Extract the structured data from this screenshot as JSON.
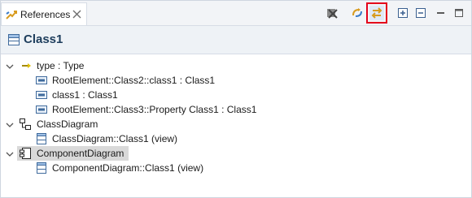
{
  "tab": {
    "label": "References"
  },
  "header": {
    "title": "Class1"
  },
  "tree": {
    "type_node": "type : Type",
    "ref1": "RootElement::Class2::class1 : Class1",
    "ref2": "class1 : Class1",
    "ref3": "RootElement::Class3::Property Class1 : Class1",
    "class_diagram": "ClassDiagram",
    "class_diagram_child": "ClassDiagram::Class1 (view)",
    "component_diagram": "ComponentDiagram",
    "component_diagram_child": "ComponentDiagram::Class1 (view)"
  },
  "colors": {
    "highlight_border": "#e4001b",
    "title": "#1d3d5c",
    "selection": "#d9d9d9"
  }
}
